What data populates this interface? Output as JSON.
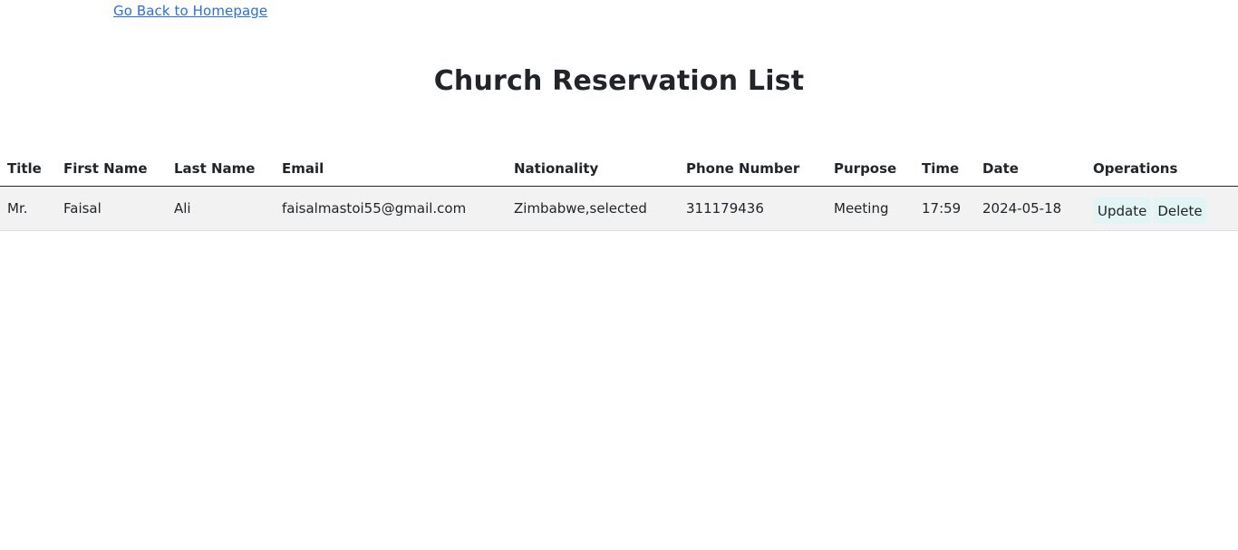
{
  "nav": {
    "back_link": "Go Back to Homepage"
  },
  "page": {
    "title": "Church Reservation List"
  },
  "table": {
    "headers": [
      "Title",
      "First Name",
      "Last Name",
      "Email",
      "Nationality",
      "Phone Number",
      "Purpose",
      "Time",
      "Date",
      "Operations"
    ],
    "rows": [
      {
        "title": "Mr.",
        "first_name": "Faisal",
        "last_name": "Ali",
        "email": "faisalmastoi55@gmail.com",
        "nationality": "Zimbabwe,selected",
        "phone": "311179436",
        "purpose": "Meeting",
        "time": "17:59",
        "date": "2024-05-18",
        "update_label": "Update",
        "delete_label": "Delete"
      }
    ]
  },
  "colors": {
    "link": "#2a6fdb",
    "row_background": "#f2f2f2",
    "button_background": "#e3f4f4",
    "text": "#212529"
  }
}
